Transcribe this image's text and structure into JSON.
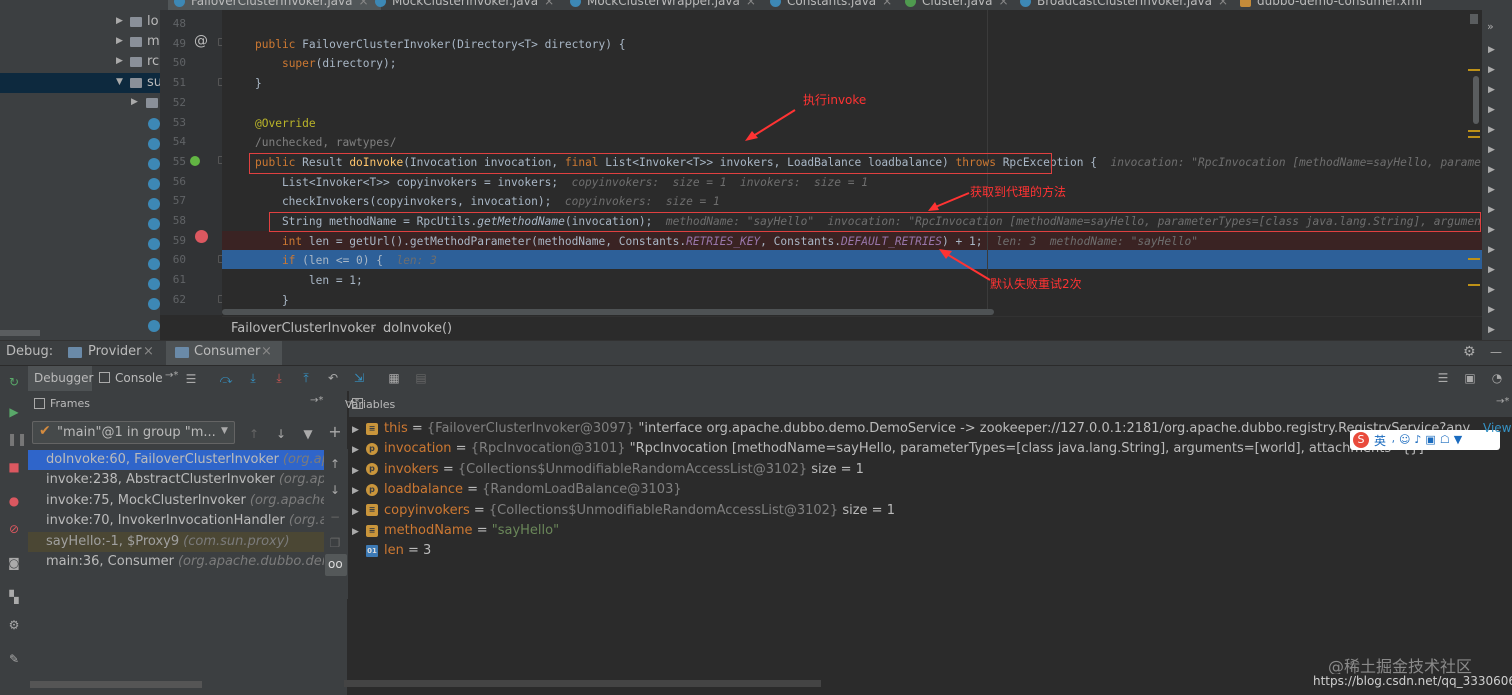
{
  "tabs": [
    {
      "label": "FailoverClusterInvoker.java"
    },
    {
      "label": "MockClusterInvoker.java"
    },
    {
      "label": "MockClusterWrapper.java"
    },
    {
      "label": "Constants.java"
    },
    {
      "label": "Cluster.java"
    },
    {
      "label": "BroadcastClusterInvoker.java"
    },
    {
      "label": "dubbo-demo-consumer.xml"
    }
  ],
  "project_tree": [
    {
      "label": "lo"
    },
    {
      "label": "m"
    },
    {
      "label": "rc"
    },
    {
      "label": "su"
    }
  ],
  "editor": {
    "line_numbers": [
      "48",
      "49",
      "50",
      "51",
      "52",
      "53",
      "54",
      "55",
      "56",
      "57",
      "58",
      "59",
      "60",
      "61",
      "62"
    ],
    "at_marker": "@",
    "lines": [
      {
        "text": ""
      },
      {
        "parts": [
          [
            "kw",
            "public "
          ],
          [
            "",
            "FailoverClusterInvoker(Directory<T> directory) {"
          ]
        ]
      },
      {
        "parts": [
          [
            "",
            "    "
          ],
          [
            "kw",
            "super"
          ],
          [
            "",
            "(directory);"
          ]
        ]
      },
      {
        "parts": [
          [
            "",
            "}"
          ]
        ]
      },
      {
        "text": ""
      },
      {
        "parts": [
          [
            "ann",
            "@Override"
          ]
        ]
      },
      {
        "parts": [
          [
            "cm",
            "/unchecked, rawtypes/"
          ]
        ]
      },
      {
        "parts": [
          [
            "kw",
            "public "
          ],
          [
            "",
            "Result "
          ],
          [
            "fn",
            "doInvoke"
          ],
          [
            "",
            "(Invocation invocation, "
          ],
          [
            "kw",
            "final "
          ],
          [
            "",
            "List<Invoker<T>> invokers, LoadBalance loadbalance) "
          ],
          [
            "kw",
            "throws "
          ],
          [
            "",
            "RpcException {  "
          ],
          [
            "hint",
            "invocation: \"RpcInvocation [methodName=sayHello, parameterTypes=[cla"
          ]
        ]
      },
      {
        "parts": [
          [
            "",
            "    List<Invoker<T>> copyinvokers = invokers;  "
          ],
          [
            "hint",
            "copyinvokers:  size = 1  invokers:  size = 1"
          ]
        ]
      },
      {
        "parts": [
          [
            "",
            "    checkInvokers(copyinvokers, invocation);  "
          ],
          [
            "hint",
            "copyinvokers:  size = 1"
          ]
        ]
      },
      {
        "parts": [
          [
            "",
            "    String methodName = RpcUtils."
          ],
          [
            "it",
            "getMethodName"
          ],
          [
            "",
            "(invocation);  "
          ],
          [
            "hint",
            "methodName: \"sayHello\"  invocation: \"RpcInvocation [methodName=sayHello, parameterTypes=[class java.lang.String], arguments=[world],"
          ]
        ]
      },
      {
        "parts": [
          [
            "kw",
            "    int "
          ],
          [
            "",
            "len = getUrl().getMethodParameter(methodName, Constants."
          ],
          [
            "st",
            "RETRIES_KEY"
          ],
          [
            "",
            ", Constants."
          ],
          [
            "st",
            "DEFAULT_RETRIES"
          ],
          [
            "",
            ") + 1;  "
          ],
          [
            "hint",
            "len: 3  methodName: \"sayHello\""
          ]
        ]
      },
      {
        "parts": [
          [
            "kw",
            "    if "
          ],
          [
            "",
            "(len <= 0) {  "
          ],
          [
            "hint",
            "len: 3"
          ]
        ]
      },
      {
        "parts": [
          [
            "",
            "        len = 1;"
          ]
        ]
      },
      {
        "parts": [
          [
            "",
            "    }"
          ]
        ]
      }
    ]
  },
  "annotations": {
    "invoke": "执行invoke",
    "proxy_method": "获取到代理的方法",
    "retries": "默认失败重试2次"
  },
  "breadcrumb": {
    "class_name": "FailoverClusterInvoker",
    "separator": "›",
    "method": "doInvoke()"
  },
  "debug": {
    "label": "Debug:",
    "run_configs": [
      {
        "label": "Provider"
      },
      {
        "label": "Consumer"
      }
    ],
    "tabs": {
      "debugger": "Debugger",
      "console": "Console"
    },
    "frames_title": "Frames",
    "variables_title": "Variables",
    "thread_select": "\"main\"@1 in group \"m...",
    "frames": [
      {
        "method": "doInvoke:60, FailoverClusterInvoker",
        "pkg": "(org.apach"
      },
      {
        "method": "invoke:238, AbstractClusterInvoker",
        "pkg": "(org.apache"
      },
      {
        "method": "invoke:75, MockClusterInvoker",
        "pkg": "(org.apache.du"
      },
      {
        "method": "invoke:70, InvokerInvocationHandler",
        "pkg": "(org.apac"
      },
      {
        "method": "sayHello:-1, $Proxy9",
        "pkg": "(com.sun.proxy)"
      },
      {
        "method": "main:36, Consumer",
        "pkg": "(org.apache.dubbo.demo.C"
      }
    ],
    "variables": [
      {
        "name": "this",
        "type": "{FailoverClusterInvoker@3097}",
        "value": "\"interface org.apache.dubbo.demo.DemoService -> zookeeper://127.0.0.1:2181/org.apache.dubbo.registry.RegistryService?anyhost=true&appli"
      },
      {
        "name": "invocation",
        "type": "{RpcInvocation@3101}",
        "value": "\"RpcInvocation [methodName=sayHello, parameterTypes=[class java.lang.String], arguments=[world], attachments={}]\""
      },
      {
        "name": "invokers",
        "type": "{Collections$UnmodifiableRandomAccessList@3102}",
        "value": "size = 1"
      },
      {
        "name": "loadbalance",
        "type": "{RandomLoadBalance@3103}",
        "value": ""
      },
      {
        "name": "copyinvokers",
        "type": "{Collections$UnmodifiableRandomAccessList@3102}",
        "value": "size = 1"
      },
      {
        "name": "methodName",
        "type": "",
        "value": "\"sayHello\""
      },
      {
        "name": "len",
        "type": "",
        "value": "3"
      }
    ]
  },
  "watermark": {
    "line1": "@稀土掘金技术社区",
    "line2": "https://blog.csdn.net/qq_33306061"
  },
  "ime": {
    "label": "英"
  },
  "right_edge": {
    "view_label": "View"
  }
}
